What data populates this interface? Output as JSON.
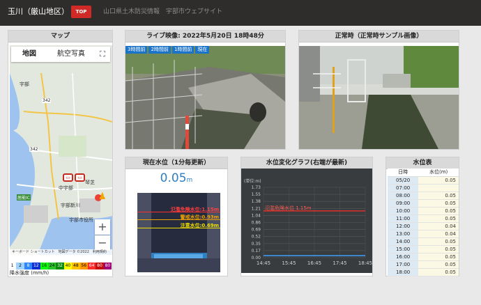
{
  "header": {
    "site_title": "玉川（厳山地区）",
    "top_button": "TOP",
    "links": [
      "山口県土木防災情報",
      "宇部市ウェブサイト"
    ]
  },
  "map_panel": {
    "title": "マップ",
    "tab_map": "地図",
    "tab_satellite": "航空写真",
    "zoom_in": "+",
    "zoom_out": "−",
    "labels": [
      "宇部",
      "342",
      "342",
      "中宇部",
      "宇部新川",
      "宇部市役所",
      "琴芝",
      "居能IC"
    ],
    "footer": "キーボード ショートカット　地図データ ©2022　利用規約",
    "rain_scale": [
      "1",
      "2",
      "8",
      "12",
      "16",
      "24",
      "32",
      "40",
      "48",
      "56",
      "64",
      "80",
      "80"
    ],
    "rain_colors": [
      "#ffffff",
      "#a0d2ff",
      "#2f87ff",
      "#0c2fd1",
      "#0aff0a",
      "#2bc52b",
      "#0a8b0a",
      "#ffff00",
      "#ffc200",
      "#ff9800",
      "#ff2a2a",
      "#c40d0d",
      "#a10075"
    ],
    "rain_label": "降水強度 (mm/h)"
  },
  "live_panel": {
    "title": "ライブ映像: 2022年5月20日 18時48分",
    "tabs": [
      "3時間前",
      "2時間前",
      "1時間前",
      "現在"
    ]
  },
  "normal_panel": {
    "title": "正常時（正常時サンプル画像）"
  },
  "level_panel": {
    "title": "現在水位（1分毎更新）",
    "value": "0.05",
    "unit": "m",
    "flood_label": "氾濫危険水位:1.15m",
    "warning_label": "警戒水位:0.93m",
    "caution_label": "注意水位:0.69m"
  },
  "graph_panel": {
    "title": "水位変化グラフ(右端が最新)",
    "unit_label": "(単位:m)",
    "y_ticks": [
      "1.73",
      "1.55",
      "1.38",
      "1.21",
      "1.04",
      "0.86",
      "0.69",
      "0.52",
      "0.35",
      "0.17",
      "0.00"
    ],
    "x_ticks": [
      "14:45",
      "15:45",
      "16:45",
      "17:45",
      "18:45"
    ],
    "threshold_label": "氾濫危険水位 1.15m"
  },
  "chart_data": {
    "type": "line",
    "x": [
      "14:45",
      "15:45",
      "16:45",
      "17:45",
      "18:45"
    ],
    "series": [
      {
        "values": [
          0.05,
          0.05,
          0.05,
          0.05,
          0.05
        ]
      }
    ],
    "ylim": [
      0.0,
      1.73
    ],
    "threshold": 1.15
  },
  "table_panel": {
    "title": "水位表",
    "col_time": "日時",
    "col_level": "水位(m)",
    "rows": [
      {
        "time": "05/20",
        "value": "0.05"
      },
      {
        "time": "07:00",
        "value": ""
      },
      {
        "time": "08:00",
        "value": "0.05"
      },
      {
        "time": "09:00",
        "value": "0.05"
      },
      {
        "time": "10:00",
        "value": "0.05"
      },
      {
        "time": "11:00",
        "value": "0.05"
      },
      {
        "time": "12:00",
        "value": "0.04"
      },
      {
        "time": "13:00",
        "value": "0.04"
      },
      {
        "time": "14:00",
        "value": "0.05"
      },
      {
        "time": "15:00",
        "value": "0.05"
      },
      {
        "time": "16:00",
        "value": "0.05"
      },
      {
        "time": "17:00",
        "value": "0.05"
      },
      {
        "time": "18:00",
        "value": "0.05"
      }
    ]
  }
}
